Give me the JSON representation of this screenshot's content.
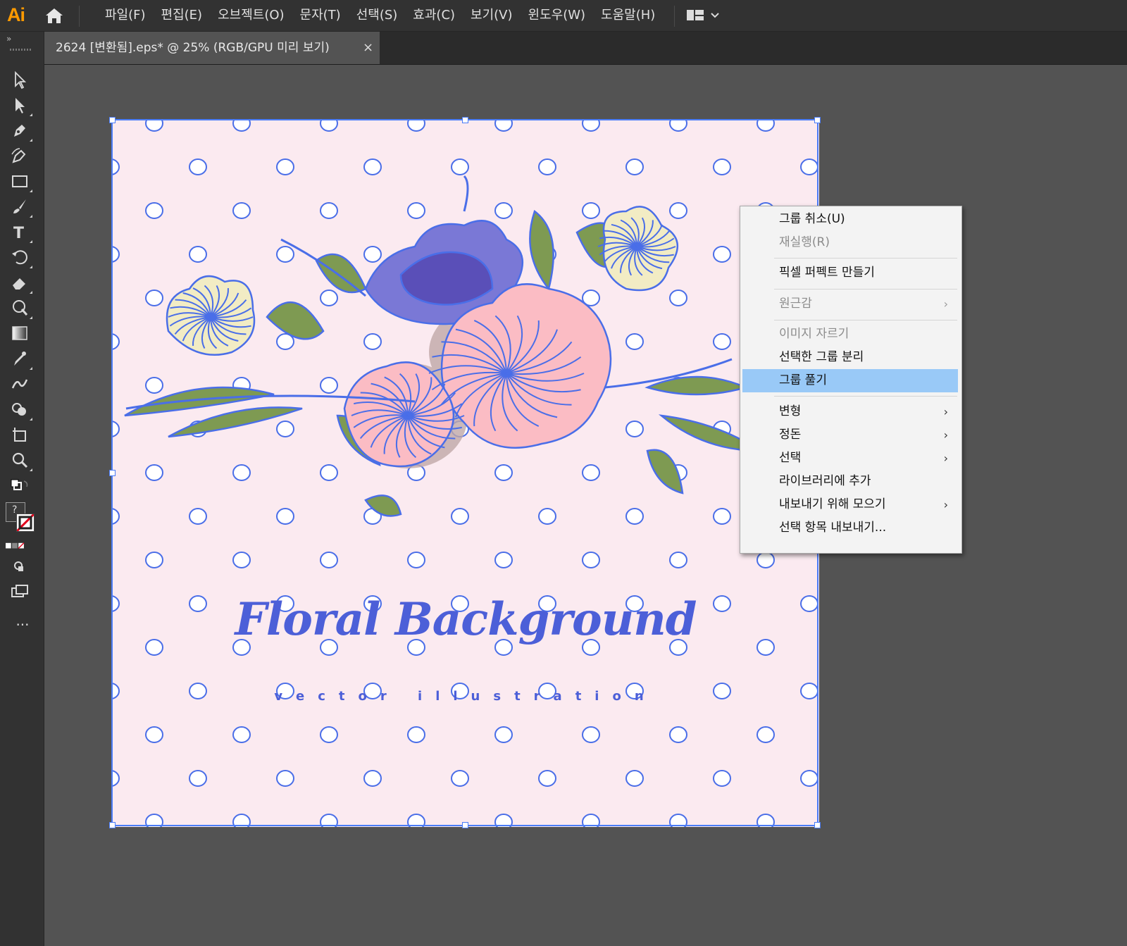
{
  "app": {
    "logo": "Ai"
  },
  "menubar": {
    "items": [
      "파일(F)",
      "편집(E)",
      "오브젝트(O)",
      "문자(T)",
      "선택(S)",
      "효과(C)",
      "보기(V)",
      "윈도우(W)",
      "도움말(H)"
    ]
  },
  "document": {
    "tab_title": "2624 [변환됨].eps* @ 25% (RGB/GPU 미리 보기)",
    "close_glyph": "×"
  },
  "toolbar": {
    "tools": [
      "selection-tool",
      "direct-selection-tool",
      "pen-tool",
      "curvature-tool",
      "rectangle-tool",
      "paintbrush-tool",
      "type-tool",
      "rotate-tool",
      "eraser-tool",
      "puppet-warp-tool",
      "gradient-tool",
      "eyedropper-tool",
      "blend-tool",
      "shape-builder-tool",
      "artboard-tool",
      "zoom-tool"
    ],
    "fill_label": "?",
    "more_label": "···"
  },
  "artboard": {
    "background_color": "#fbeaf0",
    "title": "Floral Background",
    "subtitle": "vector illustration"
  },
  "context_menu": {
    "items": [
      {
        "label": "그룹 취소(U)",
        "disabled": false,
        "submenu": false
      },
      {
        "label": "재실행(R)",
        "disabled": true,
        "submenu": false
      },
      {
        "label": "픽셀 퍼펙트 만들기",
        "disabled": false,
        "submenu": false
      },
      {
        "label": "원근감",
        "disabled": true,
        "submenu": true
      },
      {
        "label": "이미지 자르기",
        "disabled": true,
        "submenu": false
      },
      {
        "label": "선택한 그룹 분리",
        "disabled": false,
        "submenu": false
      },
      {
        "label": "그룹 풀기",
        "disabled": false,
        "submenu": false,
        "highlighted": true
      },
      {
        "label": "변형",
        "disabled": false,
        "submenu": true
      },
      {
        "label": "정돈",
        "disabled": false,
        "submenu": true
      },
      {
        "label": "선택",
        "disabled": false,
        "submenu": true
      },
      {
        "label": "라이브러리에 추가",
        "disabled": false,
        "submenu": false
      },
      {
        "label": "내보내기 위해 모으기",
        "disabled": false,
        "submenu": true
      },
      {
        "label": "선택 항목 내보내기...",
        "disabled": false,
        "submenu": false
      }
    ],
    "submenu_arrow": "›"
  },
  "colors": {
    "selection": "#4a7cf7",
    "highlight": "#99c9f7",
    "ui_dark": "#323232",
    "canvas": "#535353"
  }
}
